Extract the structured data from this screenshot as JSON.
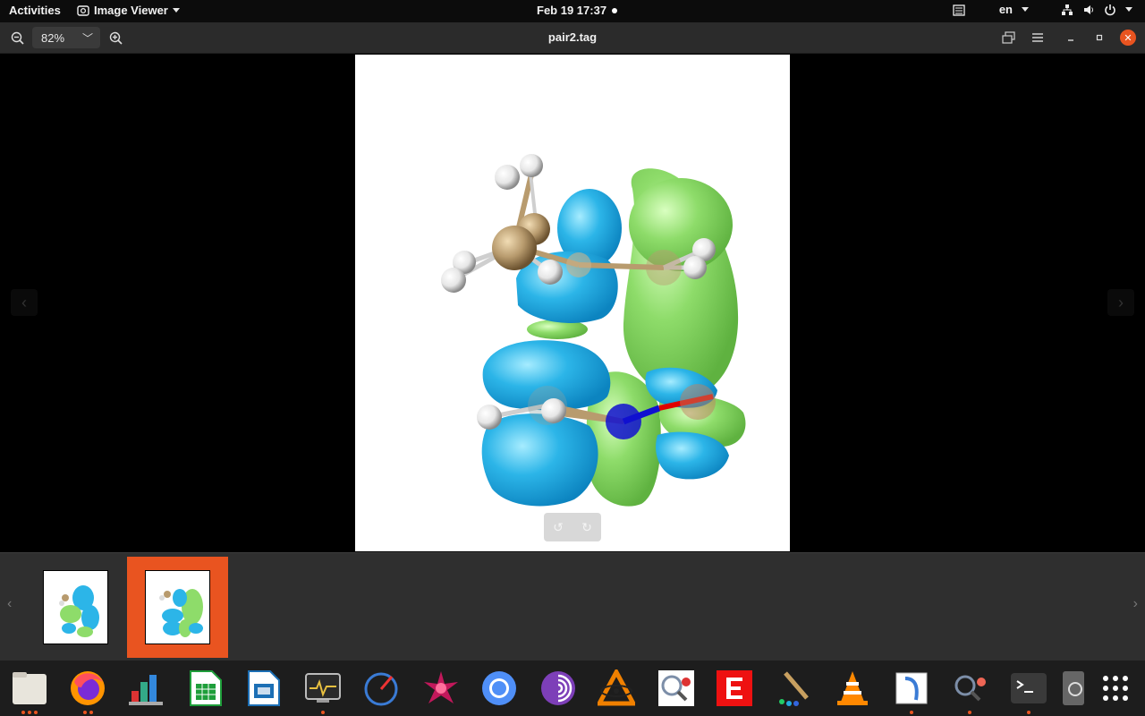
{
  "topbar": {
    "activities": "Activities",
    "app_menu": "Image Viewer",
    "clock": "Feb 19  17:37",
    "language": "en"
  },
  "header": {
    "zoom": "82%",
    "title": "pair2.tag"
  },
  "gallery": {
    "thumbnails": [
      {
        "selected": false
      },
      {
        "selected": true
      }
    ]
  },
  "dock": {
    "apps": [
      {
        "icon": "files-icon",
        "running": 3
      },
      {
        "icon": "firefox-icon",
        "running": 2
      },
      {
        "icon": "app-3d-chart-icon",
        "running": 0
      },
      {
        "icon": "libreoffice-calc-icon",
        "running": 0
      },
      {
        "icon": "libreoffice-impress-icon",
        "running": 0
      },
      {
        "icon": "system-monitor-icon",
        "running": 1
      },
      {
        "icon": "gauge-app-icon",
        "running": 0
      },
      {
        "icon": "molecule-star-icon",
        "running": 0
      },
      {
        "icon": "chromium-icon",
        "running": 0
      },
      {
        "icon": "tor-browser-icon",
        "running": 0
      },
      {
        "icon": "avogadro-icon",
        "running": 0
      },
      {
        "icon": "molecule-viewer-icon",
        "running": 0
      },
      {
        "icon": "red-e-app-icon",
        "running": 0
      },
      {
        "icon": "paint-brush-icon",
        "running": 0
      },
      {
        "icon": "vlc-icon",
        "running": 0
      },
      {
        "icon": "editor-icon",
        "running": 1
      },
      {
        "icon": "molecule-search-icon",
        "running": 1
      },
      {
        "icon": "terminal-icon",
        "running": 1
      },
      {
        "icon": "image-viewer-icon",
        "running": 0
      },
      {
        "icon": "show-apps-icon",
        "running": 0
      }
    ]
  },
  "colors": {
    "accent": "#e95420",
    "orbital_positive": "#2cb5e8",
    "orbital_negative": "#8edc6a",
    "carbon": "#b89b6e",
    "nitrogen": "#1010d0",
    "oxygen": "#e00000"
  }
}
